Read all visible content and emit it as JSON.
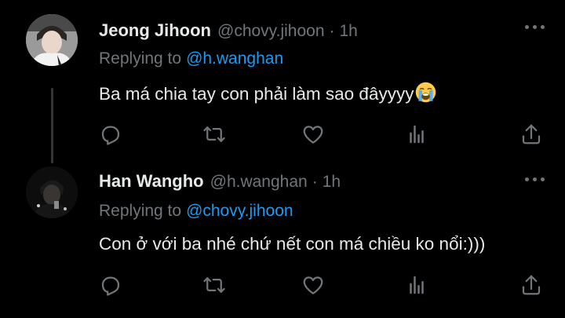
{
  "tweets": [
    {
      "display_name": "Jeong Jihoon",
      "handle": "@chovy.jihoon",
      "separator": "·",
      "time": "1h",
      "reply_prefix": "Replying to",
      "reply_target": "@h.wanghan",
      "text": "Ba má chia tay con phải làm sao đâyyyy",
      "emoji": "loudly-crying-face-emoji"
    },
    {
      "display_name": "Han Wangho",
      "handle": "@h.wanghan",
      "separator": "·",
      "time": "1h",
      "reply_prefix": "Replying to",
      "reply_target": "@chovy.jihoon",
      "text": "Con ở với ba nhé chứ nết con má chiều ko nổi:)))"
    }
  ],
  "icons": {
    "more": "more-icon",
    "reply": "reply-icon",
    "retweet": "retweet-icon",
    "like": "like-icon",
    "analytics": "analytics-icon",
    "share": "share-icon"
  },
  "colors": {
    "background": "#000000",
    "primary_text": "#e7e9ea",
    "secondary_text": "#71767b",
    "link": "#1d9bf0",
    "thread_line": "#333639"
  }
}
